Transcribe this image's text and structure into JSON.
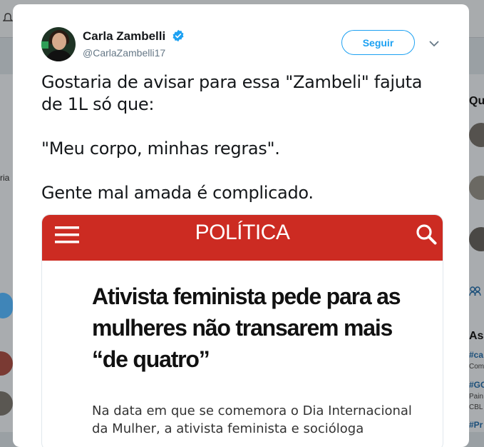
{
  "background": {
    "topright_text": "er",
    "left_text": "ria",
    "right_heading": "Qu",
    "right_section": "As",
    "trend_items": [
      {
        "tag": "#ca",
        "sub": "Com"
      },
      {
        "tag": "#GG",
        "sub": "Pain"
      },
      {
        "tag": "#Pr",
        "sub": ""
      }
    ],
    "right_sub2": "CBL"
  },
  "tweet": {
    "author_name": "Carla Zambelli",
    "handle": "@CarlaZambelli17",
    "verified": true,
    "follow_label": "Seguir",
    "text": "Gostaria de avisar para essa \"Zambeli\" fajuta de 1L só que:\n\n\"Meu corpo, minhas regras\".\n\nGente mal amada é complicado.",
    "embed": {
      "section": "POLÍTICA",
      "headline": "Ativista feminista pede para as mulheres não transarem mais “de quatro”",
      "lead": "Na data em que se comemora o Dia Internacional da Mulher, a ativista feminista e socióloga"
    }
  },
  "colors": {
    "accent": "#1da1f2",
    "news_red": "#cc2b22"
  },
  "icons": [
    "bell-icon",
    "verified-badge-icon",
    "chevron-down-icon",
    "menu-icon",
    "search-icon"
  ]
}
